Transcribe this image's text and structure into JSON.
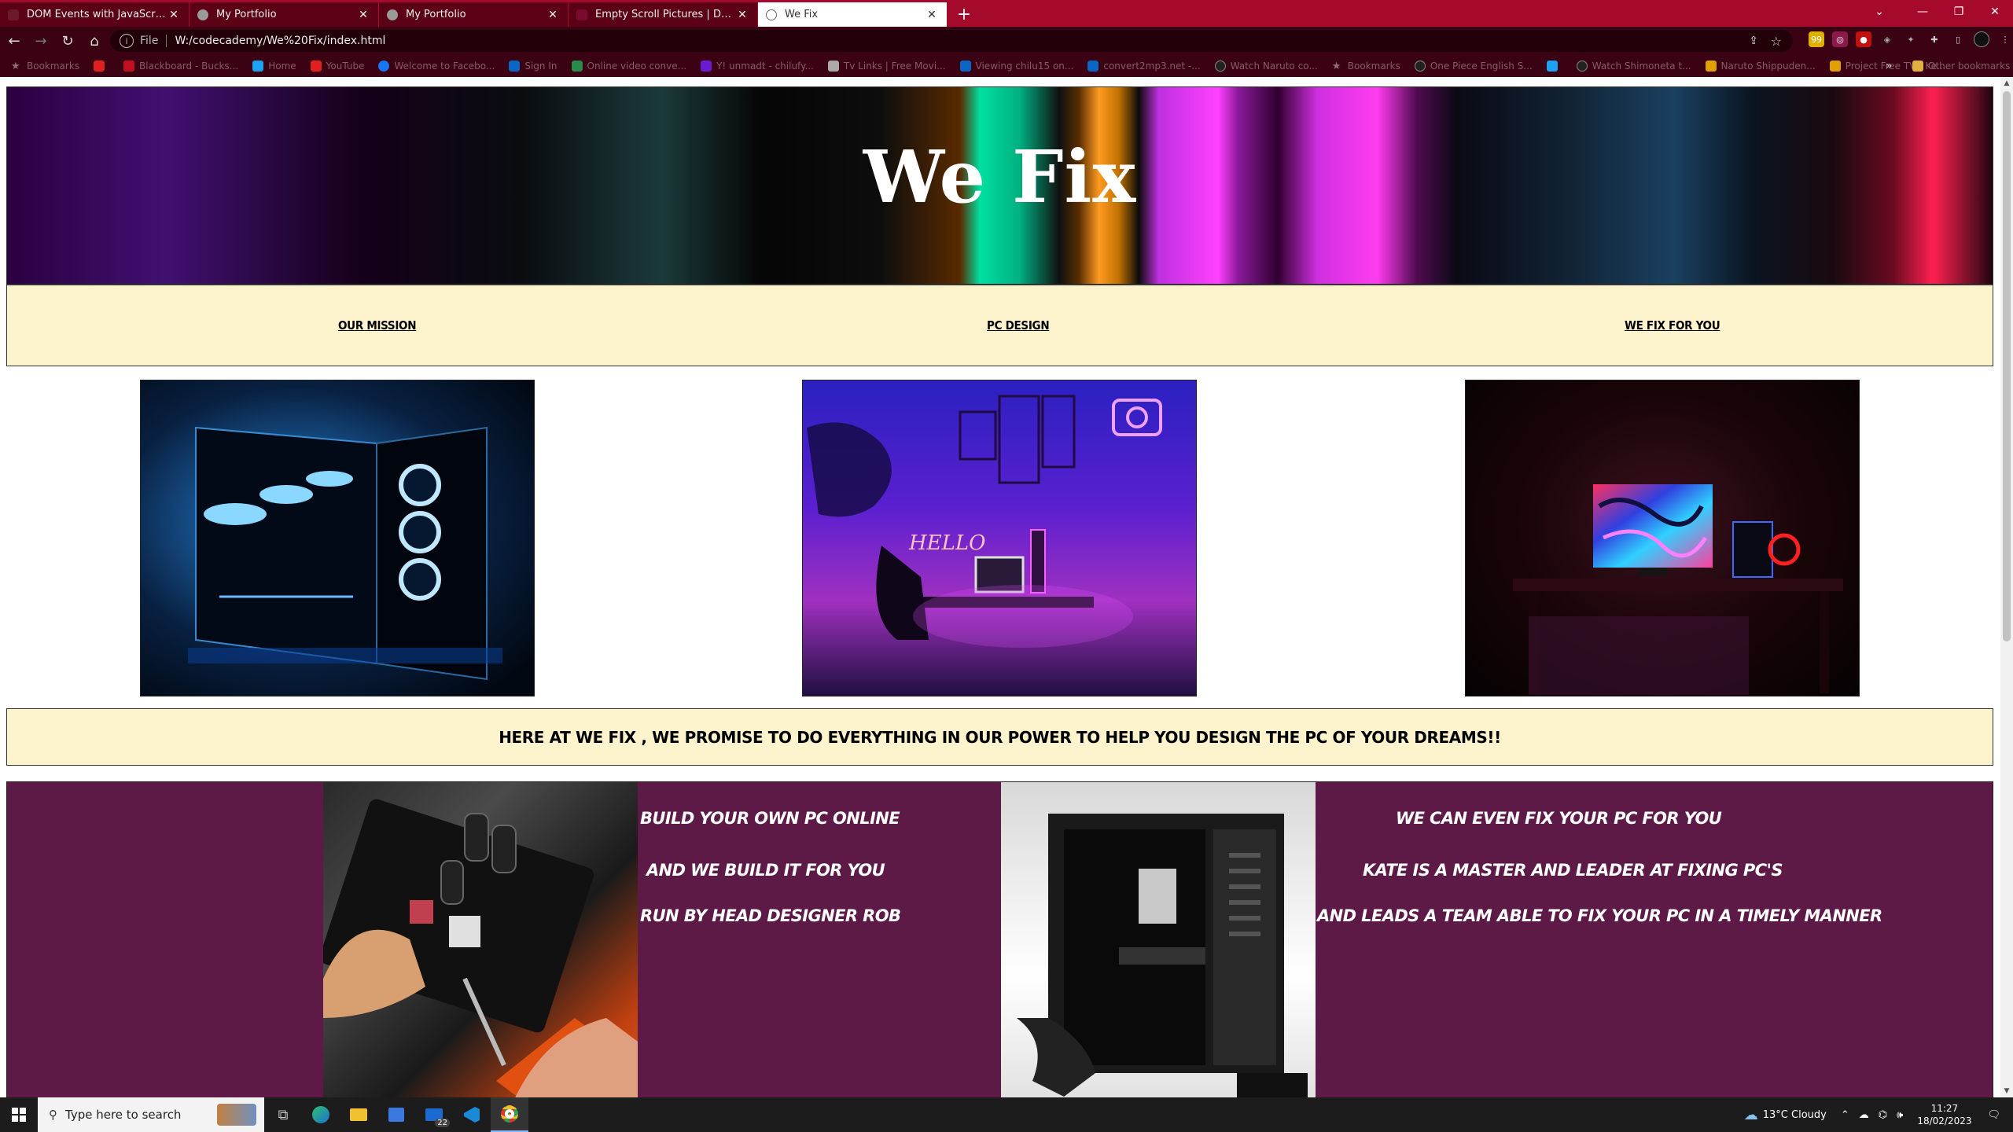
{
  "browser": {
    "tabs": [
      {
        "label": "DOM Events with JavaScript | Co",
        "favicon_color": "#6a1a2a",
        "active": false
      },
      {
        "label": "My Portfolio",
        "favicon_color": "#9a9a9a",
        "active": false
      },
      {
        "label": "My Portfolio",
        "favicon_color": "#9a9a9a",
        "active": false
      },
      {
        "label": "Empty Scroll Pictures | Downloa",
        "favicon_color": "#7a0a30",
        "active": false
      },
      {
        "label": "We Fix",
        "favicon_color": "#666666",
        "active": true
      }
    ],
    "address_scheme": "File",
    "address_url": "W:/codecademy/We%20Fix/index.html",
    "bookmarks": [
      {
        "label": "Bookmarks",
        "color": "#9a6a76"
      },
      {
        "label": "",
        "color": "#e02020"
      },
      {
        "label": "Blackboard - Bucks...",
        "color": "#c01020"
      },
      {
        "label": "Home",
        "color": "#1da1f2"
      },
      {
        "label": "YouTube",
        "color": "#e02020"
      },
      {
        "label": "Welcome to Facebo...",
        "color": "#1877f2"
      },
      {
        "label": "Sign In",
        "color": "#0a66c2"
      },
      {
        "label": "Online video conve...",
        "color": "#2a8a4a"
      },
      {
        "label": "Y! unmadt - chilufy...",
        "color": "#6a1ad0"
      },
      {
        "label": "Tv Links | Free Movi...",
        "color": "#aaaaaa"
      },
      {
        "label": "Viewing chilu15 on...",
        "color": "#0a66c2"
      },
      {
        "label": "convert2mp3.net -...",
        "color": "#0a66c2"
      },
      {
        "label": "Watch Naruto co...",
        "color": "#222222"
      },
      {
        "label": "Bookmarks",
        "color": "#9a6a76"
      },
      {
        "label": "One Piece English S...",
        "color": "#222222"
      },
      {
        "label": "",
        "color": "#1da1f2"
      },
      {
        "label": "Watch Shimoneta t...",
        "color": "#222222"
      },
      {
        "label": "Naruto Shippuden...",
        "color": "#e0a000"
      },
      {
        "label": "Project Free TV - Ke...",
        "color": "#e0a000"
      }
    ],
    "other_bookmarks": "Other bookmarks"
  },
  "page": {
    "hero_title": "We Fix",
    "nav": [
      "Our Mission",
      "PC Design",
      "We Fix For You"
    ],
    "promise": "Here at We Fix , we promise to do everything in our power to help you design the pc of your dreams!!",
    "left_lines": [
      "Build your own pc online",
      "And we build it for you",
      "Run by head designer Rob"
    ],
    "right_lines": [
      "We can even fix your pc for you",
      "Kate is a master and leader at fixing pc's",
      "and leads a team able to fix your pc in a timely manner"
    ]
  },
  "taskbar": {
    "search_placeholder": "Type here to search",
    "mail_badge": "22",
    "weather": "13°C  Cloudy",
    "time": "11:27",
    "date": "18/02/2023"
  }
}
